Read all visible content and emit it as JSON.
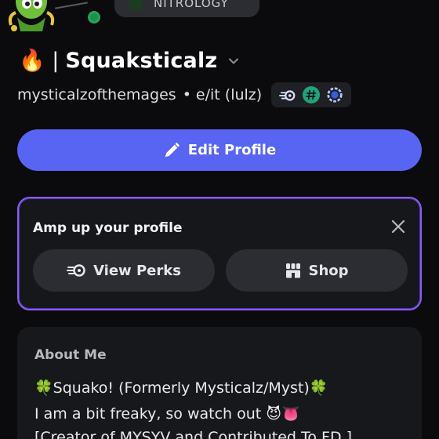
{
  "header": {
    "avatar_icon": "spike-character-avatar",
    "status": "online",
    "nitro_pill_text": "NITROLOGY"
  },
  "profile": {
    "display_name_prefix": "🔥 |",
    "display_name": "Squaksticalz",
    "username": "mysticalzofthemages",
    "pronouns": "• e/it (lulz)",
    "badges": [
      "nitro-badge",
      "hashtag-badge",
      "boost-badge"
    ]
  },
  "actions": {
    "edit_profile_label": "Edit Profile"
  },
  "amp_card": {
    "title": "Amp up your profile",
    "view_perks_label": "View Perks",
    "shop_label": "Shop"
  },
  "about": {
    "title": "About Me",
    "lines": [
      "🍀Squako! (Formerly Mysticalz/Myst)🍀",
      "I am a bit freaky, so watch out 😈👅",
      "[Creator of MYSYV and Contributed To FD ]"
    ]
  },
  "colors": {
    "accent": "#5865f2",
    "card_border": "#8b5cf6",
    "background": "#0b0b0d"
  }
}
